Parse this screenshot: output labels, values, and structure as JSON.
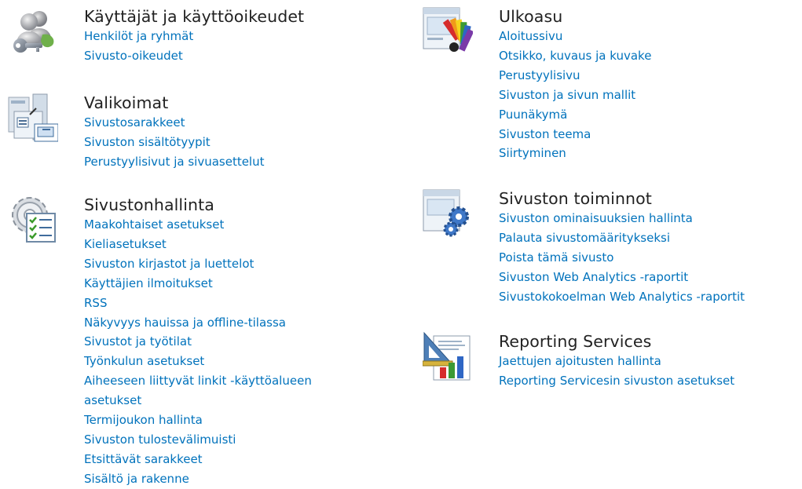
{
  "sections": {
    "users": {
      "title": "Käyttäjät ja käyttöoikeudet",
      "icon": "users-key-icon",
      "links": [
        "Henkilöt ja ryhmät",
        "Sivusto-oikeudet"
      ]
    },
    "libraries": {
      "title": "Valikoimat",
      "icon": "galleries-icon",
      "links": [
        "Sivustosarakkeet",
        "Sivuston sisältötyypit",
        "Perustyylisivut ja sivuasettelut"
      ]
    },
    "admin": {
      "title": "Sivustonhallinta",
      "icon": "site-admin-icon",
      "links": [
        "Maakohtaiset asetukset",
        "Kieliasetukset",
        "Sivuston kirjastot ja luettelot",
        "Käyttäjien ilmoitukset",
        "RSS",
        "Näkyvyys hauissa ja offline-tilassa",
        "Sivustot ja työtilat",
        "Työnkulun asetukset",
        "Aiheeseen liittyvät linkit -käyttöalueen asetukset",
        "Termijoukon hallinta",
        "Sivuston tulostevälimuisti",
        "Etsittävät sarakkeet",
        "Sisältö ja rakenne"
      ]
    },
    "look": {
      "title": "Ulkoasu",
      "icon": "look-and-feel-icon",
      "links": [
        "Aloitussivu",
        "Otsikko, kuvaus ja kuvake",
        "Perustyylisivu",
        "Sivuston ja sivun mallit",
        "Puunäkymä",
        "Sivuston teema",
        "Siirtyminen"
      ]
    },
    "actions": {
      "title": "Sivuston toiminnot",
      "icon": "site-actions-icon",
      "links": [
        "Sivuston ominaisuuksien hallinta",
        "Palauta sivustomääritykseksi",
        "Poista tämä sivusto",
        "Sivuston Web Analytics -raportit",
        "Sivustokokoelman Web Analytics -raportit"
      ]
    },
    "reporting": {
      "title": "Reporting Services",
      "icon": "reporting-services-icon",
      "links": [
        "Jaettujen ajoitusten hallinta",
        "Reporting Servicesin sivuston asetukset"
      ]
    }
  },
  "colors": {
    "link": "#0072bc",
    "heading": "#222222"
  }
}
